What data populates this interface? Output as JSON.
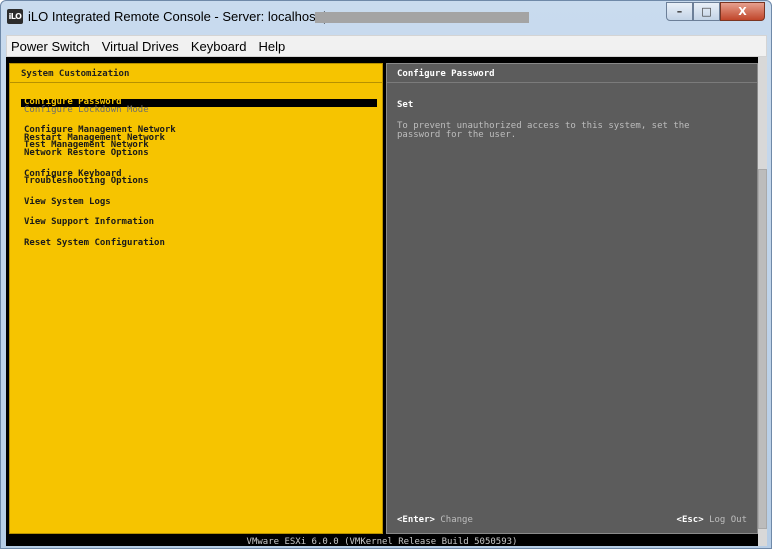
{
  "window": {
    "logo_text": "iLO",
    "title": "iLO Integrated Remote Console - Server: localhost |",
    "buttons": {
      "minimize": "–",
      "maximize": "□",
      "close": "X"
    }
  },
  "menubar": {
    "items": [
      "Power Switch",
      "Virtual Drives",
      "Keyboard",
      "Help"
    ]
  },
  "left_panel": {
    "title": "System Customization",
    "items": [
      {
        "label": "Configure Password",
        "state": "selected"
      },
      {
        "label": "Configure Lockdown Mode",
        "state": "dim"
      },
      {
        "label": "Configure Management Network",
        "state": "normal"
      },
      {
        "label": "Restart Management Network",
        "state": "normal"
      },
      {
        "label": "Test Management Network",
        "state": "normal"
      },
      {
        "label": "Network Restore Options",
        "state": "normal"
      },
      {
        "label": "Configure Keyboard",
        "state": "normal"
      },
      {
        "label": "Troubleshooting Options",
        "state": "normal"
      },
      {
        "label": "View System Logs",
        "state": "normal"
      },
      {
        "label": "View Support Information",
        "state": "normal"
      },
      {
        "label": "Reset System Configuration",
        "state": "normal"
      }
    ]
  },
  "right_panel": {
    "title": "Configure Password",
    "heading": "Set",
    "description": "To prevent unauthorized access to this system, set the\npassword for the user.",
    "footer_left_key": "<Enter>",
    "footer_left_action": "Change",
    "footer_right_key": "<Esc>",
    "footer_right_action": "Log Out"
  },
  "status_bar": {
    "text": "VMware ESXi 6.0.0 (VMKernel Release Build 5050593)"
  },
  "colors": {
    "left_panel_bg": "#f6c400",
    "right_panel_bg": "#5c5c5c",
    "console_bg": "#000000"
  }
}
